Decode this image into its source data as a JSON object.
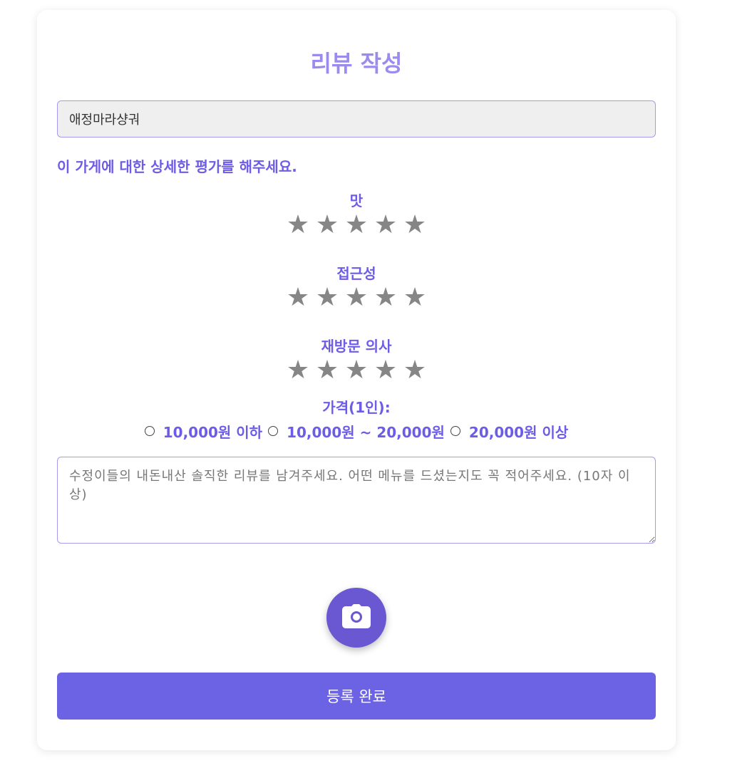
{
  "page": {
    "title": "리뷰 작성"
  },
  "store": {
    "name": "애정마라샹궈"
  },
  "evaluation": {
    "heading": "이 가게에 대한 상세한 평가를 해주세요.",
    "categories": [
      {
        "label": "맛",
        "rating": 0,
        "max": 5
      },
      {
        "label": "접근성",
        "rating": 0,
        "max": 5
      },
      {
        "label": "재방문 의사",
        "rating": 0,
        "max": 5
      }
    ],
    "star_glyph": "★",
    "star_color": "#868686"
  },
  "price": {
    "label": "가격(1인):",
    "options": [
      {
        "label": "10,000원 이하",
        "selected": false
      },
      {
        "label": "10,000원 ~ 20,000원",
        "selected": false
      },
      {
        "label": "20,000원 이상",
        "selected": false
      }
    ]
  },
  "review": {
    "value": "",
    "placeholder": "수정이들의 내돈내산 솔직한 리뷰를 남겨주세요. 어떤 메뉴를 드셨는지도 꼭 적어주세요. (10자 이상)"
  },
  "photo": {
    "icon": "camera-icon"
  },
  "submit": {
    "label": "등록 완료"
  },
  "colors": {
    "accent": "#6c5ce7",
    "title": "#9b8af0",
    "button": "#6c63e4",
    "camera_button": "#6a58d3"
  }
}
